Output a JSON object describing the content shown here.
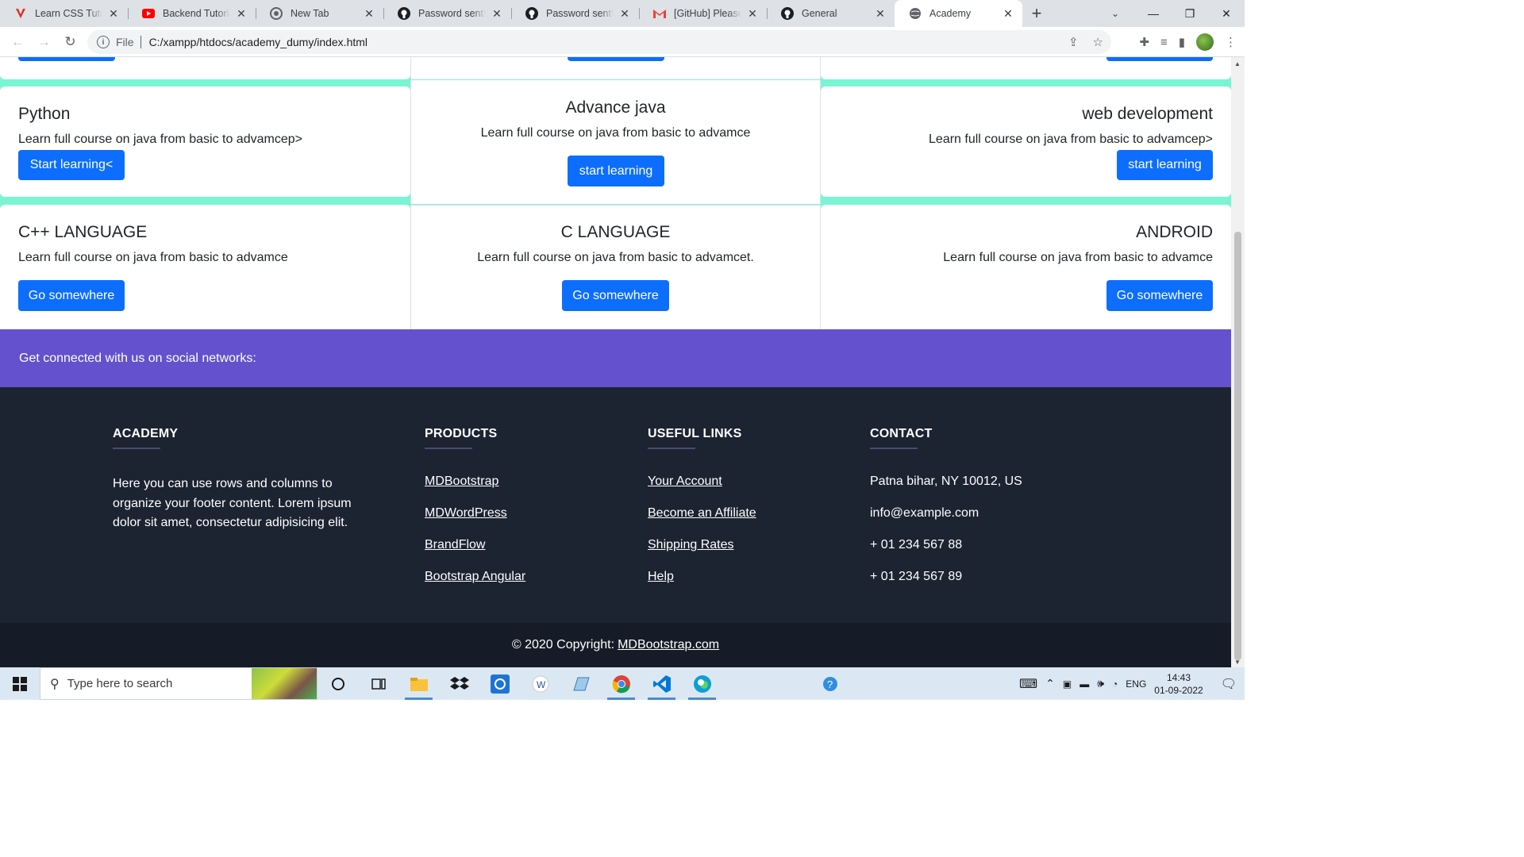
{
  "browser": {
    "tabs": [
      {
        "title": "Learn CSS Tutorial",
        "icon": "vivaldi-v-icon"
      },
      {
        "title": "Backend Tutorials",
        "icon": "youtube-icon"
      },
      {
        "title": "New Tab",
        "icon": "chrome-globe-icon"
      },
      {
        "title": "Password sent! · GitHub",
        "icon": "github-icon"
      },
      {
        "title": "Password sent! · GitHub",
        "icon": "github-icon"
      },
      {
        "title": "[GitHub] Please re",
        "icon": "gmail-icon"
      },
      {
        "title": "General",
        "icon": "github-icon"
      },
      {
        "title": "Academy",
        "icon": "globe-icon",
        "active": true
      }
    ],
    "address": {
      "scheme": "File",
      "url": "C:/xampp/htdocs/academy_dumy/index.html"
    }
  },
  "courses_row1": [
    {
      "title": "Python",
      "text": "Learn full course on java from basic to advamcep>",
      "button": "Start learning<"
    },
    {
      "title": "Advance java",
      "text": "Learn full course on java from basic to advamce",
      "button": "start learning"
    },
    {
      "title": "web development",
      "text": "Learn full course on java from basic to advamcep>",
      "button": "start learning"
    }
  ],
  "courses_row2": [
    {
      "title": "C++ LANGUAGE",
      "text": "Learn full course on java from basic to advamce",
      "button": "Go somewhere"
    },
    {
      "title": "C LANGUAGE",
      "text": "Learn full course on java from basic to advamcet.",
      "button": "Go somewhere"
    },
    {
      "title": "ANDROID",
      "text": "Learn full course on java from basic to advamce",
      "button": "Go somewhere"
    }
  ],
  "social": {
    "text": "Get connected with us on social networks:"
  },
  "footer": {
    "academy": {
      "heading": "ACADEMY",
      "text": "Here you can use rows and columns to organize your footer content. Lorem ipsum dolor sit amet, consectetur adipisicing elit."
    },
    "products": {
      "heading": "PRODUCTS",
      "links": [
        "MDBootstrap",
        "MDWordPress",
        "BrandFlow",
        "Bootstrap Angular"
      ]
    },
    "useful": {
      "heading": "USEFUL LINKS",
      "links": [
        "Your Account",
        "Become an Affiliate",
        "Shipping Rates",
        "Help"
      ]
    },
    "contact": {
      "heading": "CONTACT",
      "lines": [
        "Patna bihar, NY 10012, US",
        "info@example.com",
        "+ 01 234 567 88",
        "+ 01 234 567 89"
      ]
    },
    "copyright": {
      "prefix": "© 2020 Copyright:",
      "link": "MDBootstrap.com"
    }
  },
  "taskbar": {
    "search_placeholder": "Type here to search",
    "lang": "ENG",
    "time": "14:43",
    "date": "01-09-2022"
  },
  "colors": {
    "accent": "#0d6efd",
    "page_bg": "#7af5d4",
    "social_bar": "#6351ce",
    "footer": "#1c2331"
  }
}
